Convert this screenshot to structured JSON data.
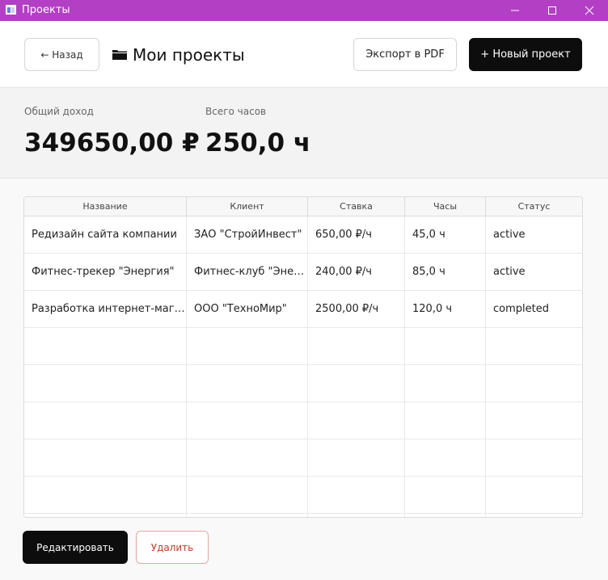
{
  "window": {
    "title": "Проекты"
  },
  "header": {
    "back_label": "← Назад",
    "title": "Мои проекты",
    "export_label": "Экспорт в PDF",
    "new_project_label": "+ Новый проект"
  },
  "stats": {
    "income_label": "Общий доход",
    "income_value": "349650,00 ₽",
    "hours_label": "Всего часов",
    "hours_value": "250,0 ч"
  },
  "table": {
    "columns": [
      "Название",
      "Клиент",
      "Ставка",
      "Часы",
      "Статус"
    ],
    "rows": [
      [
        "Редизайн сайта компании",
        "ЗАО \"СтройИнвест\"",
        "650,00 ₽/ч",
        "45,0 ч",
        "active"
      ],
      [
        "Фитнес-трекер \"Энергия\"",
        "Фитнес-клуб \"Эне…",
        "240,00 ₽/ч",
        "85,0 ч",
        "active"
      ],
      [
        "Разработка интернет-мага…",
        "ООО \"ТехноМир\"",
        "2500,00 ₽/ч",
        "120,0 ч",
        "completed"
      ]
    ]
  },
  "footer": {
    "edit_label": "Редактировать",
    "delete_label": "Удалить"
  },
  "colors": {
    "titlebar": "#b23fc4",
    "primary": "#0d0d0d",
    "danger": "#c0392b"
  }
}
